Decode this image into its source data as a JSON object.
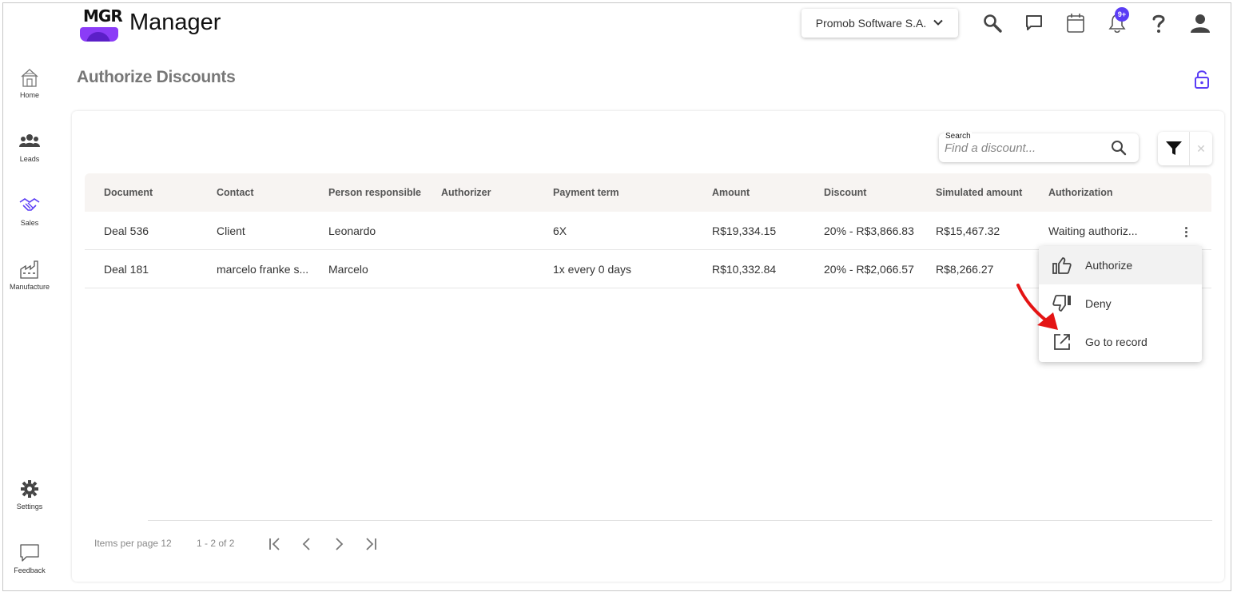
{
  "header": {
    "logo_text": "MGR",
    "app_name": "Manager",
    "company": "Promob Software S.A.",
    "notification_badge": "9+"
  },
  "sidebar": {
    "items": [
      {
        "label": "Home",
        "icon": "home-icon"
      },
      {
        "label": "Leads",
        "icon": "people-icon"
      },
      {
        "label": "Sales",
        "icon": "handshake-icon"
      },
      {
        "label": "Manufacture",
        "icon": "factory-icon"
      },
      {
        "label": "Settings",
        "icon": "gear-icon"
      },
      {
        "label": "Feedback",
        "icon": "chat-icon"
      }
    ]
  },
  "page": {
    "title": "Authorize Discounts"
  },
  "search": {
    "label": "Search",
    "placeholder": "Find a discount..."
  },
  "table": {
    "columns": [
      "Document",
      "Contact",
      "Person responsible",
      "Authorizer",
      "Payment term",
      "Amount",
      "Discount",
      "Simulated amount",
      "Authorization"
    ],
    "rows": [
      {
        "document": "Deal 536",
        "contact": "Client",
        "person": "Leonardo",
        "authorizer": "",
        "payment_term": "6X",
        "amount": "R$19,334.15",
        "discount": "20% - R$3,866.83",
        "simulated": "R$15,467.32",
        "authorization": "Waiting authoriz..."
      },
      {
        "document": "Deal 181",
        "contact": "marcelo franke s...",
        "person": "Marcelo",
        "authorizer": "",
        "payment_term": "1x every 0 days",
        "amount": "R$10,332.84",
        "discount": "20% - R$2,066.57",
        "simulated": "R$8,266.27",
        "authorization": ""
      }
    ]
  },
  "menu": {
    "items": [
      {
        "label": "Authorize",
        "icon": "thumbs-up-icon"
      },
      {
        "label": "Deny",
        "icon": "thumbs-down-icon"
      },
      {
        "label": "Go to record",
        "icon": "open-external-icon"
      }
    ]
  },
  "paginator": {
    "items_per_page": "Items per page 12",
    "range": "1 - 2 of 2"
  },
  "colors": {
    "accent": "#5b3df5",
    "brand_purple": "#8b3cf7",
    "annotation_arrow": "#e41414"
  }
}
